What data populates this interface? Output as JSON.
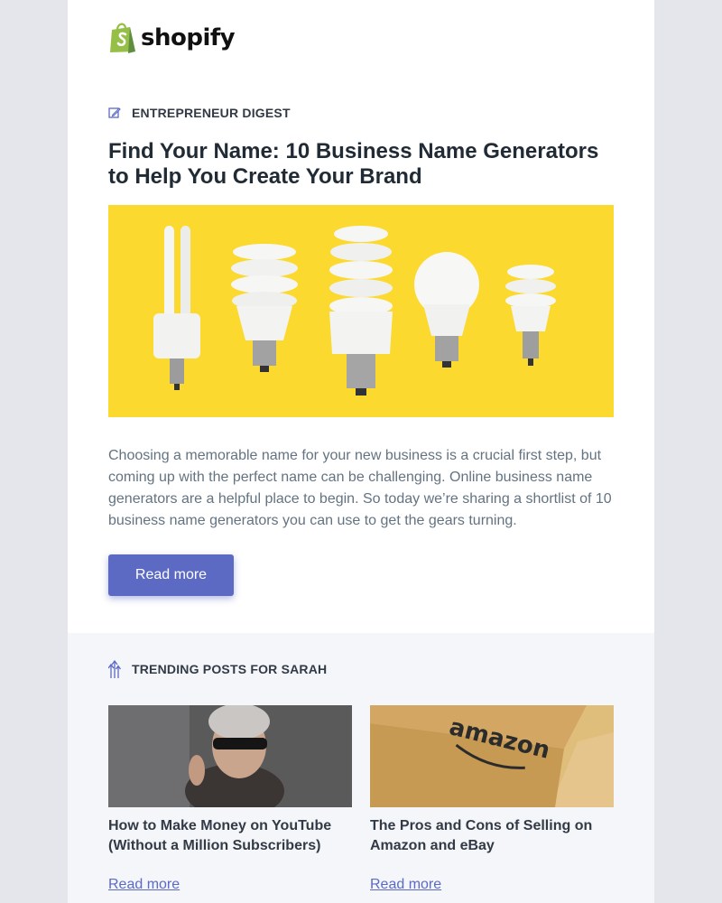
{
  "brand": {
    "name": "shopify",
    "accent": "#5c6ac4",
    "logo_green": "#95bf47"
  },
  "article": {
    "category_icon": "pencil-square-icon",
    "category": "ENTREPRENEUR DIGEST",
    "title": "Find Your Name: 10 Business Name Generators to Help You Create Your Brand",
    "body": "Choosing a memorable name for your new business is a crucial first step, but coming up with the perfect name can be challenging. Online business name generators are a helpful place to begin. So today we’re sharing a shortlist of 10 business name generators you can use to get the gears turning.",
    "cta": "Read more"
  },
  "trending": {
    "icon": "trending-arrows-icon",
    "heading": "TRENDING POSTS FOR SARAH",
    "posts": [
      {
        "title": "How to Make Money on YouTube (Without a Million Subscribers)",
        "link": "Read more"
      },
      {
        "title": "The Pros and Cons of Selling on Amazon and eBay",
        "link": "Read more",
        "image_text": "amazon"
      }
    ]
  }
}
